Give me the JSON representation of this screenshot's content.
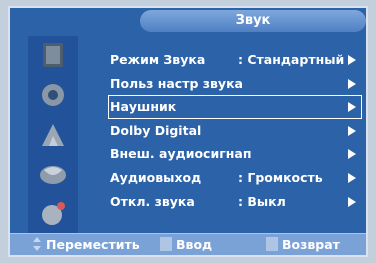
{
  "menu_title": "Звук",
  "items": [
    {
      "label": "Режим Звука",
      "value": ": Стандартный"
    },
    {
      "label": "Польз настр звука",
      "value": ""
    },
    {
      "label": "Наушник",
      "value": ""
    },
    {
      "label": "Dolby Digital",
      "value": ""
    },
    {
      "label": "Внеш. аудиосигнап",
      "value": ""
    },
    {
      "label": "Аудиовыход",
      "value": ": Громкость"
    },
    {
      "label": "Откл. звука",
      "value": ": Выкл"
    }
  ],
  "selected_item": "Наушник",
  "nav_icons": [
    "picture-icon",
    "sound-icon",
    "channel-icon",
    "setup-icon",
    "input-icon"
  ],
  "help": {
    "move": "Переместить",
    "enter": "Ввод",
    "return": "Возврат"
  },
  "colors": {
    "panel": "#2b62a8",
    "title_bar": "#5d8ccc",
    "help_bar": "#7aa2d6",
    "text": "#ffffff"
  }
}
